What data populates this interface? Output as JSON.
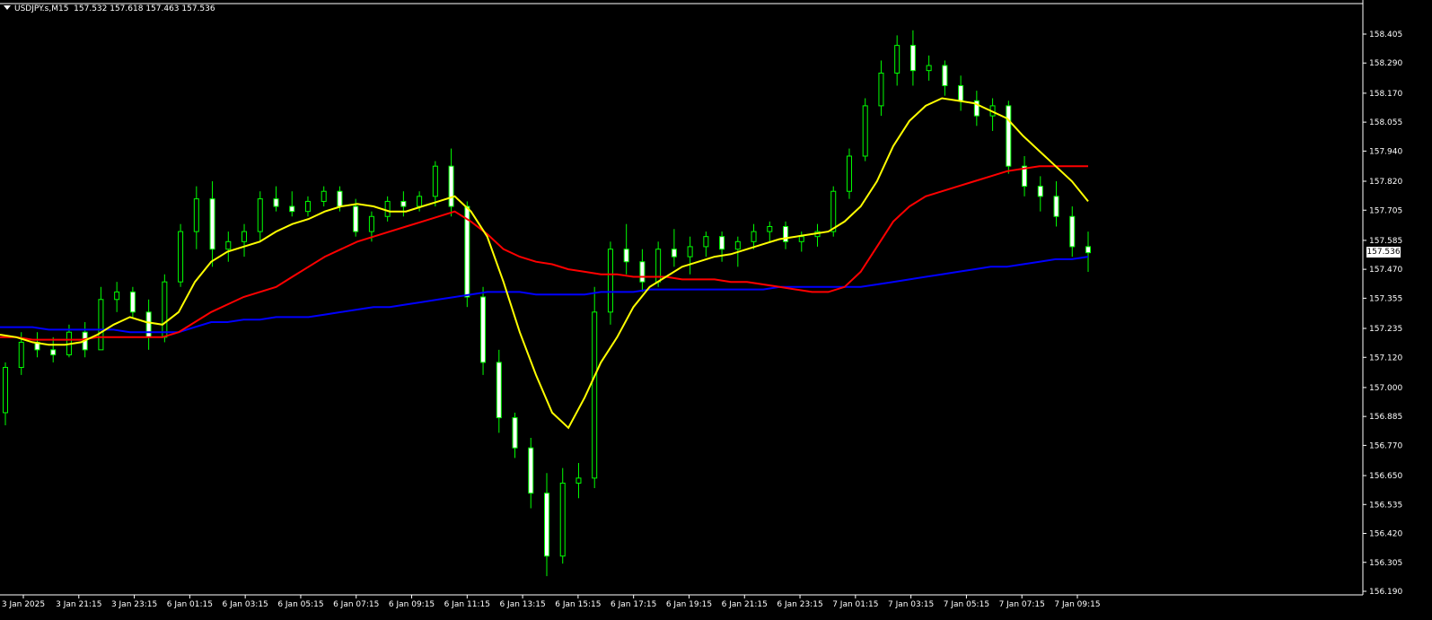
{
  "header": {
    "symbol": "USDJPY.s,M15",
    "ohlc": "157.532 157.618 157.463 157.536"
  },
  "price_scale": {
    "labels": [
      "158.405",
      "158.290",
      "158.170",
      "158.055",
      "157.940",
      "157.820",
      "157.705",
      "157.585",
      "157.470",
      "157.355",
      "157.235",
      "157.120",
      "157.000",
      "156.885",
      "156.770",
      "156.650",
      "156.535",
      "156.420",
      "156.305",
      "156.190"
    ],
    "current_price": "157.536"
  },
  "time_axis": {
    "labels": [
      "3 Jan 2025",
      "3 Jan 21:15",
      "3 Jan 23:15",
      "6 Jan 01:15",
      "6 Jan 03:15",
      "6 Jan 05:15",
      "6 Jan 07:15",
      "6 Jan 09:15",
      "6 Jan 11:15",
      "6 Jan 13:15",
      "6 Jan 15:15",
      "6 Jan 17:15",
      "6 Jan 19:15",
      "6 Jan 21:15",
      "6 Jan 23:15",
      "7 Jan 01:15",
      "7 Jan 03:15",
      "7 Jan 05:15",
      "7 Jan 07:15",
      "7 Jan 09:15"
    ]
  },
  "colors": {
    "background": "#000000",
    "axis": "#ffffff",
    "candle": "#00ff00",
    "candle_bull_fill": "#000000",
    "candle_bear_fill": "#ffffff",
    "ma_fast": "#ffff00",
    "ma_mid": "#ff0000",
    "ma_slow": "#0000ff"
  },
  "chart_data": {
    "type": "candlestick",
    "ylim": [
      156.19,
      158.405
    ],
    "grid": false,
    "x": [
      "3 Jan 2025",
      "3 Jan 21:15",
      "3 Jan 23:15",
      "6 Jan 01:15",
      "6 Jan 03:15",
      "6 Jan 05:15",
      "6 Jan 07:15",
      "6 Jan 09:15",
      "6 Jan 11:15",
      "6 Jan 13:15",
      "6 Jan 15:15",
      "6 Jan 17:15",
      "6 Jan 19:15",
      "6 Jan 21:15",
      "6 Jan 23:15",
      "7 Jan 01:15",
      "7 Jan 03:15",
      "7 Jan 05:15",
      "7 Jan 07:15",
      "7 Jan 09:15"
    ],
    "candles": [
      [
        156.9,
        157.1,
        156.85,
        157.08
      ],
      [
        157.08,
        157.22,
        157.05,
        157.18
      ],
      [
        157.18,
        157.22,
        157.12,
        157.15
      ],
      [
        157.15,
        157.2,
        157.1,
        157.13
      ],
      [
        157.13,
        157.25,
        157.12,
        157.22
      ],
      [
        157.22,
        157.26,
        157.12,
        157.15
      ],
      [
        157.15,
        157.4,
        157.15,
        157.35
      ],
      [
        157.35,
        157.42,
        157.3,
        157.38
      ],
      [
        157.38,
        157.4,
        157.28,
        157.3
      ],
      [
        157.3,
        157.35,
        157.15,
        157.2
      ],
      [
        157.2,
        157.45,
        157.18,
        157.42
      ],
      [
        157.42,
        157.65,
        157.4,
        157.62
      ],
      [
        157.62,
        157.8,
        157.55,
        157.75
      ],
      [
        157.75,
        157.82,
        157.48,
        157.55
      ],
      [
        157.55,
        157.62,
        157.5,
        157.58
      ],
      [
        157.58,
        157.65,
        157.52,
        157.62
      ],
      [
        157.62,
        157.78,
        157.58,
        157.75
      ],
      [
        157.75,
        157.8,
        157.7,
        157.72
      ],
      [
        157.72,
        157.78,
        157.68,
        157.7
      ],
      [
        157.7,
        157.76,
        157.68,
        157.74
      ],
      [
        157.74,
        157.8,
        157.72,
        157.78
      ],
      [
        157.78,
        157.8,
        157.7,
        157.72
      ],
      [
        157.72,
        157.75,
        157.6,
        157.62
      ],
      [
        157.62,
        157.7,
        157.58,
        157.68
      ],
      [
        157.68,
        157.76,
        157.66,
        157.74
      ],
      [
        157.74,
        157.78,
        157.68,
        157.72
      ],
      [
        157.72,
        157.78,
        157.7,
        157.76
      ],
      [
        157.76,
        157.9,
        157.72,
        157.88
      ],
      [
        157.88,
        157.95,
        157.68,
        157.72
      ],
      [
        157.72,
        157.74,
        157.32,
        157.36
      ],
      [
        157.36,
        157.4,
        157.05,
        157.1
      ],
      [
        157.1,
        157.15,
        156.82,
        156.88
      ],
      [
        156.88,
        156.9,
        156.72,
        156.76
      ],
      [
        156.76,
        156.8,
        156.52,
        156.58
      ],
      [
        156.58,
        156.66,
        156.25,
        156.33
      ],
      [
        156.33,
        156.68,
        156.3,
        156.62
      ],
      [
        156.62,
        156.7,
        156.56,
        156.64
      ],
      [
        156.64,
        157.4,
        156.6,
        157.3
      ],
      [
        157.3,
        157.58,
        157.25,
        157.55
      ],
      [
        157.55,
        157.65,
        157.45,
        157.5
      ],
      [
        157.5,
        157.55,
        157.38,
        157.42
      ],
      [
        157.42,
        157.58,
        157.4,
        157.55
      ],
      [
        157.55,
        157.63,
        157.48,
        157.52
      ],
      [
        157.52,
        157.6,
        157.45,
        157.56
      ],
      [
        157.56,
        157.62,
        157.52,
        157.6
      ],
      [
        157.6,
        157.62,
        157.5,
        157.55
      ],
      [
        157.55,
        157.6,
        157.48,
        157.58
      ],
      [
        157.58,
        157.65,
        157.55,
        157.62
      ],
      [
        157.62,
        157.66,
        157.58,
        157.64
      ],
      [
        157.64,
        157.66,
        157.55,
        157.58
      ],
      [
        157.58,
        157.62,
        157.54,
        157.6
      ],
      [
        157.6,
        157.65,
        157.56,
        157.62
      ],
      [
        157.62,
        157.8,
        157.6,
        157.78
      ],
      [
        157.78,
        157.95,
        157.75,
        157.92
      ],
      [
        157.92,
        158.15,
        157.9,
        158.12
      ],
      [
        158.12,
        158.3,
        158.08,
        158.25
      ],
      [
        158.25,
        158.4,
        158.2,
        158.36
      ],
      [
        158.36,
        158.42,
        158.2,
        158.26
      ],
      [
        158.26,
        158.32,
        158.22,
        158.28
      ],
      [
        158.28,
        158.3,
        158.16,
        158.2
      ],
      [
        158.2,
        158.24,
        158.1,
        158.14
      ],
      [
        158.14,
        158.18,
        158.04,
        158.08
      ],
      [
        158.08,
        158.15,
        158.02,
        158.12
      ],
      [
        158.12,
        158.14,
        157.85,
        157.88
      ],
      [
        157.88,
        157.92,
        157.76,
        157.8
      ],
      [
        157.8,
        157.84,
        157.7,
        157.76
      ],
      [
        157.76,
        157.82,
        157.64,
        157.68
      ],
      [
        157.68,
        157.72,
        157.52,
        157.56
      ],
      [
        157.56,
        157.62,
        157.46,
        157.536
      ]
    ],
    "ma_fast": [
      157.21,
      157.2,
      157.18,
      157.17,
      157.17,
      157.18,
      157.21,
      157.25,
      157.28,
      157.26,
      157.25,
      157.3,
      157.42,
      157.5,
      157.54,
      157.56,
      157.58,
      157.62,
      157.65,
      157.67,
      157.7,
      157.72,
      157.73,
      157.72,
      157.7,
      157.7,
      157.72,
      157.74,
      157.76,
      157.7,
      157.6,
      157.42,
      157.22,
      157.05,
      156.9,
      156.84,
      156.96,
      157.1,
      157.2,
      157.32,
      157.4,
      157.44,
      157.48,
      157.5,
      157.52,
      157.53,
      157.55,
      157.57,
      157.59,
      157.6,
      157.61,
      157.62,
      157.66,
      157.72,
      157.82,
      157.96,
      158.06,
      158.12,
      158.15,
      158.14,
      158.13,
      158.1,
      158.07,
      158.0,
      157.94,
      157.88,
      157.82,
      157.74
    ],
    "ma_mid": [
      157.2,
      157.2,
      157.19,
      157.19,
      157.19,
      157.19,
      157.2,
      157.2,
      157.2,
      157.2,
      157.2,
      157.22,
      157.26,
      157.3,
      157.33,
      157.36,
      157.38,
      157.4,
      157.44,
      157.48,
      157.52,
      157.55,
      157.58,
      157.6,
      157.62,
      157.64,
      157.66,
      157.68,
      157.7,
      157.66,
      157.61,
      157.55,
      157.52,
      157.5,
      157.49,
      157.47,
      157.46,
      157.45,
      157.45,
      157.44,
      157.44,
      157.44,
      157.43,
      157.43,
      157.43,
      157.42,
      157.42,
      157.41,
      157.4,
      157.39,
      157.38,
      157.38,
      157.4,
      157.46,
      157.56,
      157.66,
      157.72,
      157.76,
      157.78,
      157.8,
      157.82,
      157.84,
      157.86,
      157.87,
      157.88,
      157.88,
      157.88,
      157.88
    ],
    "ma_slow": [
      157.24,
      157.24,
      157.24,
      157.23,
      157.23,
      157.23,
      157.23,
      157.23,
      157.22,
      157.22,
      157.22,
      157.22,
      157.24,
      157.26,
      157.26,
      157.27,
      157.27,
      157.28,
      157.28,
      157.28,
      157.29,
      157.3,
      157.31,
      157.32,
      157.32,
      157.33,
      157.34,
      157.35,
      157.36,
      157.37,
      157.38,
      157.38,
      157.38,
      157.37,
      157.37,
      157.37,
      157.37,
      157.38,
      157.38,
      157.38,
      157.39,
      157.39,
      157.39,
      157.39,
      157.39,
      157.39,
      157.39,
      157.39,
      157.4,
      157.4,
      157.4,
      157.4,
      157.4,
      157.4,
      157.41,
      157.42,
      157.43,
      157.44,
      157.45,
      157.46,
      157.47,
      157.48,
      157.48,
      157.49,
      157.5,
      157.51,
      157.51,
      157.52
    ]
  }
}
